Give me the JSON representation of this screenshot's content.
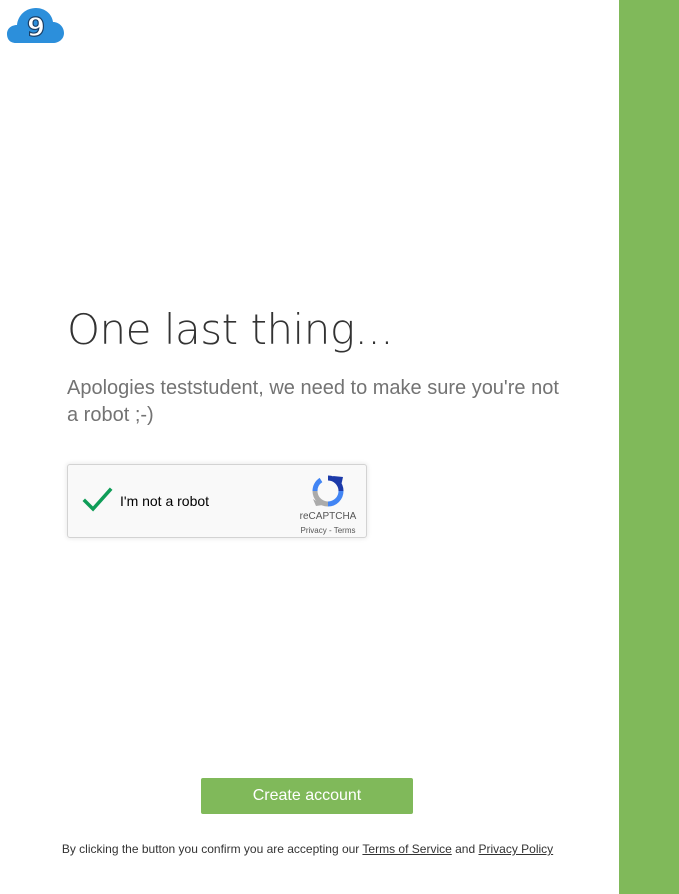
{
  "logo": {
    "icon": "cloud9-logo",
    "glyph": "9",
    "color": "#2c8fdb"
  },
  "main": {
    "heading": "One last thing...",
    "subtitle": "Apologies teststudent, we need to make sure you're not a robot ;-)"
  },
  "recaptcha": {
    "checked": true,
    "label": "I'm not a robot",
    "brand": "reCAPTCHA",
    "privacy_link": "Privacy",
    "separator": " - ",
    "terms_link": "Terms",
    "check_color": "#0f9d58"
  },
  "actions": {
    "create_label": "Create account",
    "button_color": "#80b95a"
  },
  "footer": {
    "text_before": "By clicking the button you confirm you are accepting our ",
    "terms_link": "Terms of Service",
    "and_text": " and ",
    "privacy_link": "Privacy Policy"
  },
  "sidebar": {
    "color": "#80b95a"
  }
}
